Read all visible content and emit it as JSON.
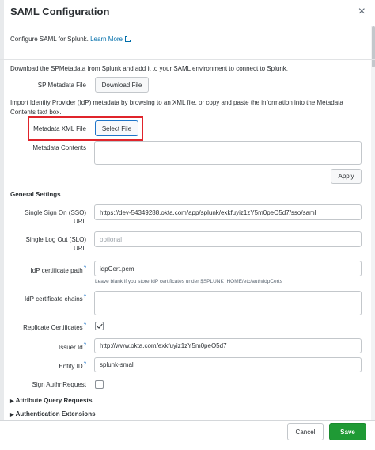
{
  "dialog": {
    "title": "SAML Configuration",
    "close_icon": "×"
  },
  "intro": {
    "text": "Configure SAML for Splunk. ",
    "link": "Learn More"
  },
  "download": {
    "description": "Download the SPMetadata from Splunk and add it to your SAML environment to connect to Splunk.",
    "label": "SP Metadata File",
    "button": "Download File"
  },
  "import": {
    "description_line1": "Import Identity Provider (IdP) metadata by browsing to an XML file, or copy and paste the information into the Metadata",
    "description_line2": "Contents text box.",
    "xml_label": "Metadata XML File",
    "select_button": "Select File",
    "contents_label": "Metadata Contents",
    "apply_button": "Apply"
  },
  "general": {
    "heading": "General Settings",
    "sso_label_1": "Single Sign On (SSO)",
    "sso_label_2": "URL",
    "sso_value": "https://dev-54349288.okta.com/app/splunk/exkfuyiz1zY5m0peO5d7/sso/saml",
    "slo_label_1": "Single Log Out (SLO)",
    "slo_label_2": "URL",
    "slo_placeholder": "optional",
    "idp_cert_path_label": "IdP certificate path",
    "idp_cert_path_value": "idpCert.pem",
    "idp_cert_path_help": "Leave blank if you store IdP certificates under $SPLUNK_HOME/etc/auth/idpCerts",
    "idp_cert_chains_label": "IdP certificate chains",
    "replicate_label": "Replicate Certificates",
    "replicate_checked": true,
    "issuer_label": "Issuer Id",
    "issuer_value": "http://www.okta.com/exkfuyiz1zY5m0peO5d7",
    "entity_label": "Entity ID",
    "entity_value": "splunk-smal",
    "sign_authn_label": "Sign AuthnRequest",
    "sign_authn_checked": false,
    "help_marker": "?"
  },
  "expanders": {
    "attribute_query": "Attribute Query Requests",
    "authentication_extensions": "Authentication Extensions"
  },
  "footer": {
    "cancel": "Cancel",
    "save": "Save"
  },
  "colors": {
    "accent": "#1d74c9",
    "save_green": "#1f9a35",
    "highlight_red": "#e0242b",
    "link": "#006eaa"
  }
}
